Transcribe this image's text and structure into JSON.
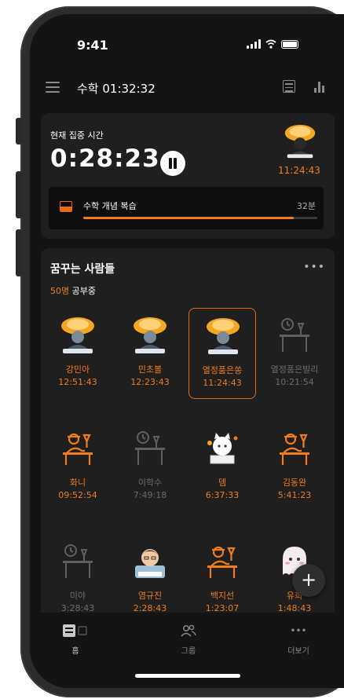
{
  "status": {
    "time": "9:41"
  },
  "header": {
    "title": "수학  01:32:32"
  },
  "focus": {
    "label": "현재 집중 시간",
    "time": "0:28:23",
    "avatar_time": "11:24:43",
    "task": {
      "name": "수학 개념 복습",
      "minutes": "32분",
      "progress": 0.9
    }
  },
  "people": {
    "title": "꿈꾸는 사람들",
    "count": "50명",
    "studying_suffix": " 공부중",
    "items": [
      {
        "name": "강민아",
        "time": "12:51:43",
        "status": "active",
        "icon": "avatar-burst"
      },
      {
        "name": "민초볼",
        "time": "12:23:43",
        "status": "active",
        "icon": "avatar-burst"
      },
      {
        "name": "열정품은쏭",
        "time": "11:24:43",
        "status": "active",
        "icon": "avatar-burst",
        "selected": true
      },
      {
        "name": "열정품은빌리",
        "time": "10:21:54",
        "status": "idle",
        "icon": "desk"
      },
      {
        "name": "화니",
        "time": "09:52:54",
        "status": "active",
        "icon": "studying-person"
      },
      {
        "name": "이학수",
        "time": "7:49:18",
        "status": "idle",
        "icon": "desk"
      },
      {
        "name": "뎀",
        "time": "6:37:33",
        "status": "active",
        "icon": "cat-avatar"
      },
      {
        "name": "김동완",
        "time": "5:41:23",
        "status": "active",
        "icon": "studying-person"
      },
      {
        "name": "미야",
        "time": "3:28:43",
        "status": "idle",
        "icon": "desk"
      },
      {
        "name": "염규진",
        "time": "2:28:43",
        "status": "active",
        "icon": "boy-avatar"
      },
      {
        "name": "백지선",
        "time": "1:23:07",
        "status": "active",
        "icon": "studying-person"
      },
      {
        "name": "유희",
        "time": "1:48:43",
        "status": "active",
        "icon": "ghost-avatar"
      }
    ]
  },
  "tabs": [
    {
      "label": "홈",
      "icon": "home-icon"
    },
    {
      "label": "그룹",
      "icon": "group-icon"
    },
    {
      "label": "더보기",
      "icon": "more-icon"
    }
  ],
  "colors": {
    "accent": "#f07c1e",
    "bg": "#141414",
    "card": "#1f1f1f"
  }
}
